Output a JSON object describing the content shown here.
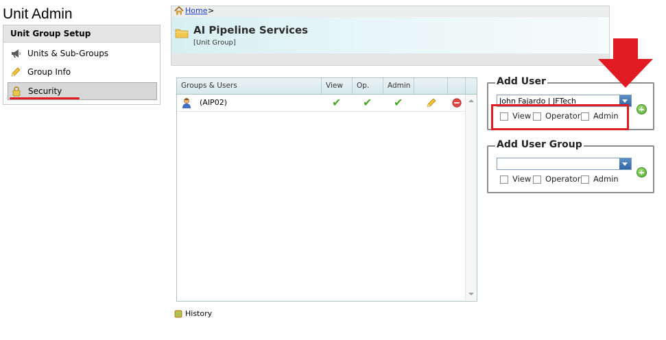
{
  "app": {
    "title": "Unit Admin"
  },
  "sidebar": {
    "header": "Unit Group Setup",
    "items": [
      {
        "label": "Units & Sub-Groups",
        "icon": "megaphone-icon"
      },
      {
        "label": "Group Info",
        "icon": "pencil-icon"
      },
      {
        "label": "Security",
        "icon": "lock-icon",
        "selected": true
      }
    ]
  },
  "breadcrumb": {
    "home": "Home",
    "separator": ">"
  },
  "unit": {
    "title": "AI Pipeline Services",
    "subtitle": "[Unit Group]"
  },
  "grid": {
    "columns": [
      "Groups & Users",
      "View",
      "Op.",
      "Admin"
    ],
    "rows": [
      {
        "name": "(AIP02)",
        "view": true,
        "operator": true,
        "admin": true
      }
    ]
  },
  "add_user": {
    "title": "Add User",
    "selected": "John Fajardo | JFTech",
    "options": [
      "View",
      "Operator",
      "Admin"
    ]
  },
  "add_user_group": {
    "title": "Add User Group",
    "selected": "",
    "options": [
      "View",
      "Operator",
      "Admin"
    ]
  },
  "footer": {
    "history": "History"
  },
  "colors": {
    "highlight": "#e11b22",
    "check": "#4aa82e",
    "link": "#1a3ccf"
  }
}
